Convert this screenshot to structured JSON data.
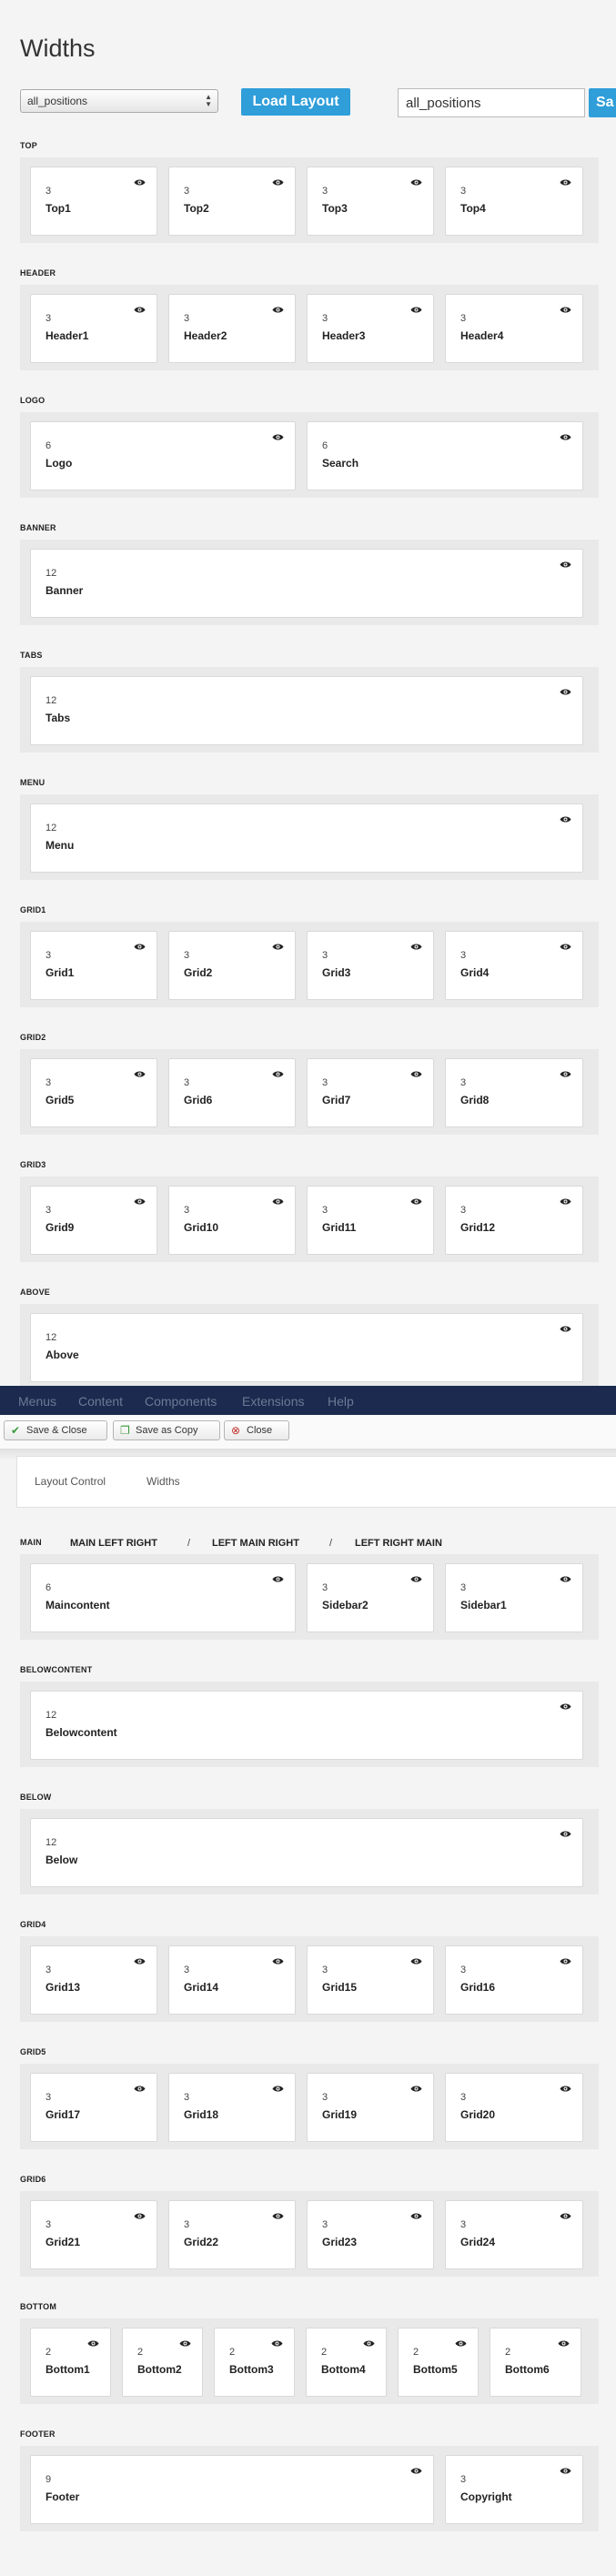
{
  "page_title": "Widths",
  "layout_select": {
    "value": "all_positions"
  },
  "load_button_label": "Load Layout",
  "layout_name_input": {
    "value": "all_positions"
  },
  "save_button_partial_label": "Sa",
  "rows": [
    {
      "label": "TOP",
      "positions": [
        {
          "width": "3",
          "name": "Top1"
        },
        {
          "width": "3",
          "name": "Top2"
        },
        {
          "width": "3",
          "name": "Top3"
        },
        {
          "width": "3",
          "name": "Top4"
        }
      ]
    },
    {
      "label": "HEADER",
      "positions": [
        {
          "width": "3",
          "name": "Header1"
        },
        {
          "width": "3",
          "name": "Header2"
        },
        {
          "width": "3",
          "name": "Header3"
        },
        {
          "width": "3",
          "name": "Header4"
        }
      ]
    },
    {
      "label": "LOGO",
      "positions": [
        {
          "width": "6",
          "name": "Logo"
        },
        {
          "width": "6",
          "name": "Search"
        }
      ]
    },
    {
      "label": "BANNER",
      "positions": [
        {
          "width": "12",
          "name": "Banner"
        }
      ]
    },
    {
      "label": "TABS",
      "positions": [
        {
          "width": "12",
          "name": "Tabs"
        }
      ]
    },
    {
      "label": "MENU",
      "positions": [
        {
          "width": "12",
          "name": "Menu"
        }
      ]
    },
    {
      "label": "GRID1",
      "positions": [
        {
          "width": "3",
          "name": "Grid1"
        },
        {
          "width": "3",
          "name": "Grid2"
        },
        {
          "width": "3",
          "name": "Grid3"
        },
        {
          "width": "3",
          "name": "Grid4"
        }
      ]
    },
    {
      "label": "GRID2",
      "positions": [
        {
          "width": "3",
          "name": "Grid5"
        },
        {
          "width": "3",
          "name": "Grid6"
        },
        {
          "width": "3",
          "name": "Grid7"
        },
        {
          "width": "3",
          "name": "Grid8"
        }
      ]
    },
    {
      "label": "GRID3",
      "positions": [
        {
          "width": "3",
          "name": "Grid9"
        },
        {
          "width": "3",
          "name": "Grid10"
        },
        {
          "width": "3",
          "name": "Grid11"
        },
        {
          "width": "3",
          "name": "Grid12"
        }
      ]
    },
    {
      "label": "ABOVE",
      "positions": [
        {
          "width": "12",
          "name": "Above"
        }
      ]
    },
    {
      "label": "MAIN",
      "positions": [
        {
          "width": "6",
          "name": "Maincontent"
        },
        {
          "width": "3",
          "name": "Sidebar2"
        },
        {
          "width": "3",
          "name": "Sidebar1"
        }
      ]
    },
    {
      "label": "BELOWCONTENT",
      "positions": [
        {
          "width": "12",
          "name": "Belowcontent"
        }
      ]
    },
    {
      "label": "BELOW",
      "positions": [
        {
          "width": "12",
          "name": "Below"
        }
      ]
    },
    {
      "label": "GRID4",
      "positions": [
        {
          "width": "3",
          "name": "Grid13"
        },
        {
          "width": "3",
          "name": "Grid14"
        },
        {
          "width": "3",
          "name": "Grid15"
        },
        {
          "width": "3",
          "name": "Grid16"
        }
      ]
    },
    {
      "label": "GRID5",
      "positions": [
        {
          "width": "3",
          "name": "Grid17"
        },
        {
          "width": "3",
          "name": "Grid18"
        },
        {
          "width": "3",
          "name": "Grid19"
        },
        {
          "width": "3",
          "name": "Grid20"
        }
      ]
    },
    {
      "label": "GRID6",
      "positions": [
        {
          "width": "3",
          "name": "Grid21"
        },
        {
          "width": "3",
          "name": "Grid22"
        },
        {
          "width": "3",
          "name": "Grid23"
        },
        {
          "width": "3",
          "name": "Grid24"
        }
      ]
    },
    {
      "label": "BOTTOM",
      "positions": [
        {
          "width": "2",
          "name": "Bottom1"
        },
        {
          "width": "2",
          "name": "Bottom2"
        },
        {
          "width": "2",
          "name": "Bottom3"
        },
        {
          "width": "2",
          "name": "Bottom4"
        },
        {
          "width": "2",
          "name": "Bottom5"
        },
        {
          "width": "2",
          "name": "Bottom6"
        }
      ]
    },
    {
      "label": "FOOTER",
      "positions": [
        {
          "width": "9",
          "name": "Footer"
        },
        {
          "width": "3",
          "name": "Copyright"
        }
      ]
    }
  ],
  "main_options": [
    "MAIN LEFT RIGHT",
    "LEFT MAIN RIGHT",
    "LEFT RIGHT MAIN"
  ],
  "main_options_separator": "/",
  "top_menu": [
    "Menus",
    "Content",
    "Components",
    "Extensions",
    "Help"
  ],
  "toolbar": {
    "save_close": "Save & Close",
    "save_copy": "Save as Copy",
    "close": "Close"
  },
  "panel_tabs": [
    "Layout Control",
    "Widths"
  ],
  "colors": {
    "accent": "#2f9ed9",
    "navbar": "#1b2a4e",
    "row_background": "#e9e9e9"
  },
  "icons": {
    "visibility": "eye-icon",
    "save_close": "check-icon",
    "save_copy": "copy-icon",
    "close": "close-circle-icon"
  }
}
